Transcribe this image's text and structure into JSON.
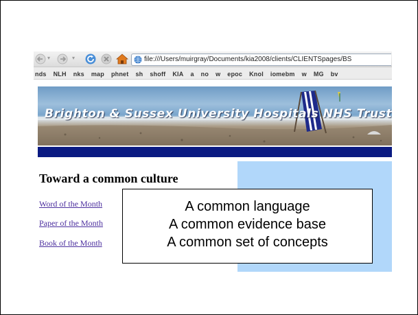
{
  "browser": {
    "url": "file:///Users/muirgray/Documents/kia2008/clients/CLIENTSpages/BS",
    "bookmarks": [
      "nds",
      "NLH",
      "nks",
      "map",
      "phnet",
      "sh",
      "shoff",
      "KIA",
      "a",
      "no",
      "w",
      "epoc",
      "Knol",
      "iomebm",
      "w",
      "MG",
      "bv"
    ]
  },
  "page": {
    "banner_title": "Brighton & Sussex University Hospitals NHS Trust",
    "heading": "Toward a common culture",
    "links": [
      "Word of the Month",
      "Paper of the Month",
      "Book of the Month"
    ]
  },
  "callout": {
    "lines": [
      "A common language",
      "A common evidence base",
      "A common set of concepts"
    ]
  },
  "colors": {
    "navy_bar": "#0a1a82",
    "side_panel": "#b1d7fa",
    "link": "#4b2e9e"
  },
  "icons": [
    "back-arrow-icon",
    "forward-arrow-icon",
    "reload-icon",
    "stop-icon",
    "home-icon",
    "globe-icon"
  ]
}
